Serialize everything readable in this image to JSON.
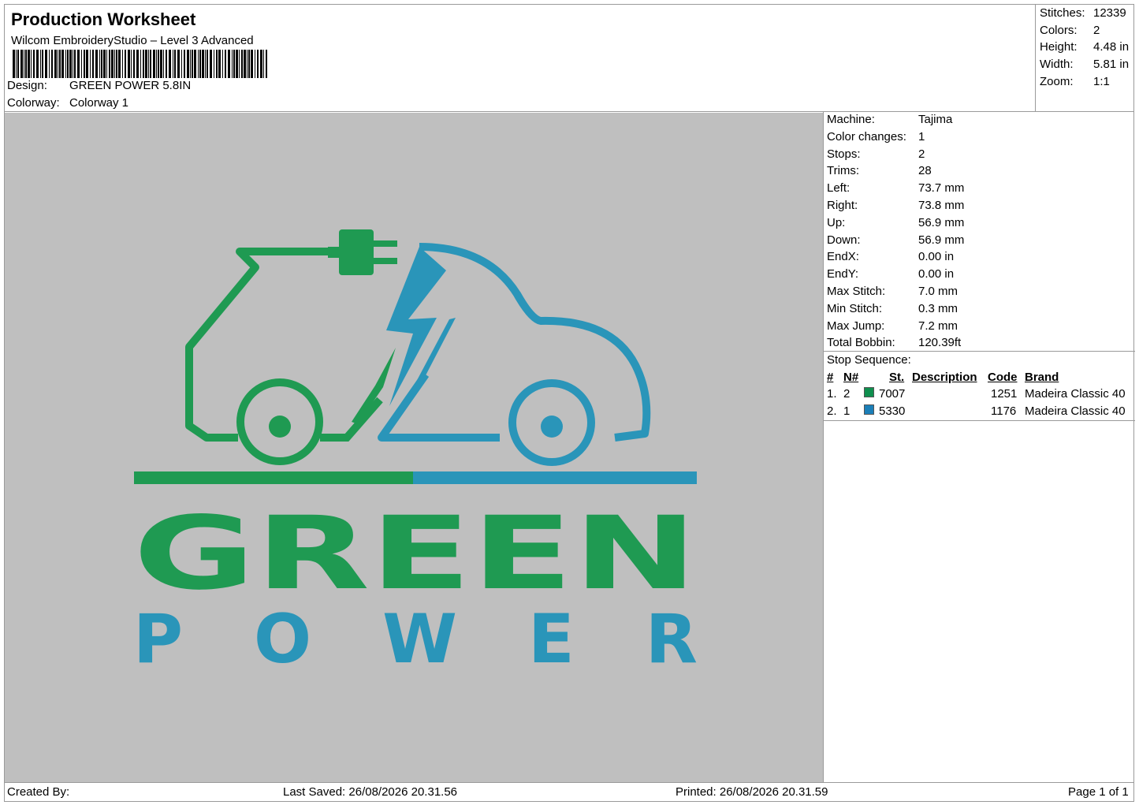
{
  "header": {
    "title": "Production Worksheet",
    "software": "Wilcom EmbroideryStudio – Level 3 Advanced",
    "design_label": "Design:",
    "design_value": "GREEN POWER 5.8IN",
    "colorway_label": "Colorway:",
    "colorway_value": "Colorway 1"
  },
  "summary": [
    {
      "label": "Stitches:",
      "value": "12339"
    },
    {
      "label": "Colors:",
      "value": "2"
    },
    {
      "label": "Height:",
      "value": "4.48 in"
    },
    {
      "label": "Width:",
      "value": "5.81 in"
    },
    {
      "label": "Zoom:",
      "value": "1:1"
    }
  ],
  "machine_info": [
    {
      "label": "Machine:",
      "value": "Tajima"
    },
    {
      "label": "Color changes:",
      "value": "1"
    },
    {
      "label": "Stops:",
      "value": "2"
    },
    {
      "label": "Trims:",
      "value": "28"
    },
    {
      "label": "Left:",
      "value": "73.7 mm"
    },
    {
      "label": "Right:",
      "value": "73.8 mm"
    },
    {
      "label": "Up:",
      "value": "56.9 mm"
    },
    {
      "label": "Down:",
      "value": "56.9 mm"
    },
    {
      "label": "EndX:",
      "value": "0.00 in"
    },
    {
      "label": "EndY:",
      "value": "0.00 in"
    },
    {
      "label": "Max Stitch:",
      "value": "7.0 mm"
    },
    {
      "label": "Min Stitch:",
      "value": "0.3 mm"
    },
    {
      "label": "Max Jump:",
      "value": "7.2 mm"
    },
    {
      "label": "Total Bobbin:",
      "value": "120.39ft"
    }
  ],
  "stop_sequence": {
    "title": "Stop Sequence:",
    "columns": {
      "idx": "#",
      "n": "N#",
      "st": "St.",
      "desc": "Description",
      "code": "Code",
      "brand": "Brand"
    },
    "rows": [
      {
        "idx": "1.",
        "n": "2",
        "color": "#0f8f4e",
        "st": "7007",
        "desc": "",
        "code": "1251",
        "brand": "Madeira Classic 40"
      },
      {
        "idx": "2.",
        "n": "1",
        "color": "#1b7fb8",
        "st": "5330",
        "desc": "",
        "code": "1176",
        "brand": "Madeira Classic 40"
      }
    ]
  },
  "design_text": {
    "line1": "GREEN",
    "line2": "POWER"
  },
  "colors": {
    "green": "#1f9a52",
    "blue": "#2a95b9",
    "canvas": "#bfbfbf"
  },
  "footer": {
    "created_by": "Created By:",
    "last_saved": "Last Saved: 26/08/2026 20.31.56",
    "printed": "Printed: 26/08/2026 20.31.59",
    "page": "Page 1 of 1"
  }
}
